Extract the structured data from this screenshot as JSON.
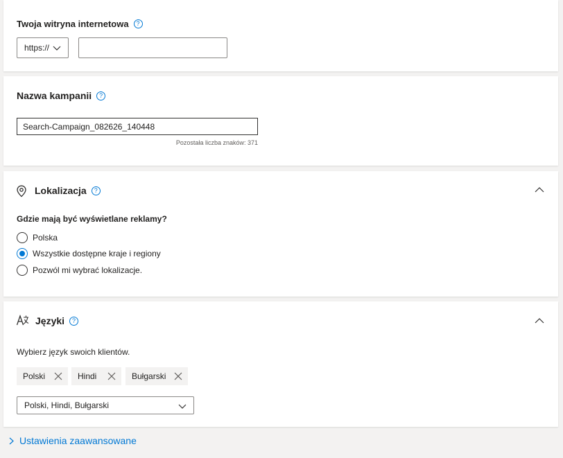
{
  "website": {
    "title": "Twoja witryna internetowa",
    "protocol_value": "https://",
    "url_value": ""
  },
  "campaign": {
    "title": "Nazwa kampanii",
    "name_value": "Search-Campaign_082626_140448",
    "remaining_chars": "Pozostała liczba znaków: 371"
  },
  "location": {
    "title": "Lokalizacja",
    "question": "Gdzie mają być wyświetlane reklamy?",
    "options": [
      {
        "label": "Polska",
        "checked": false
      },
      {
        "label": "Wszystkie dostępne kraje i regiony",
        "checked": true
      },
      {
        "label": "Pozwól mi wybrać lokalizacje.",
        "checked": false
      }
    ]
  },
  "languages": {
    "title": "Języki",
    "subtitle": "Wybierz język swoich klientów.",
    "tags": [
      "Polski",
      "Hindi",
      "Bułgarski"
    ],
    "select_value": "Polski, Hindi, Bułgarski"
  },
  "advanced": {
    "label": "Ustawienia zaawansowane"
  },
  "help_glyph": "?",
  "colors": {
    "accent": "#0078d4",
    "background": "#f3f2f1",
    "card": "#ffffff",
    "text": "#201f1e"
  }
}
